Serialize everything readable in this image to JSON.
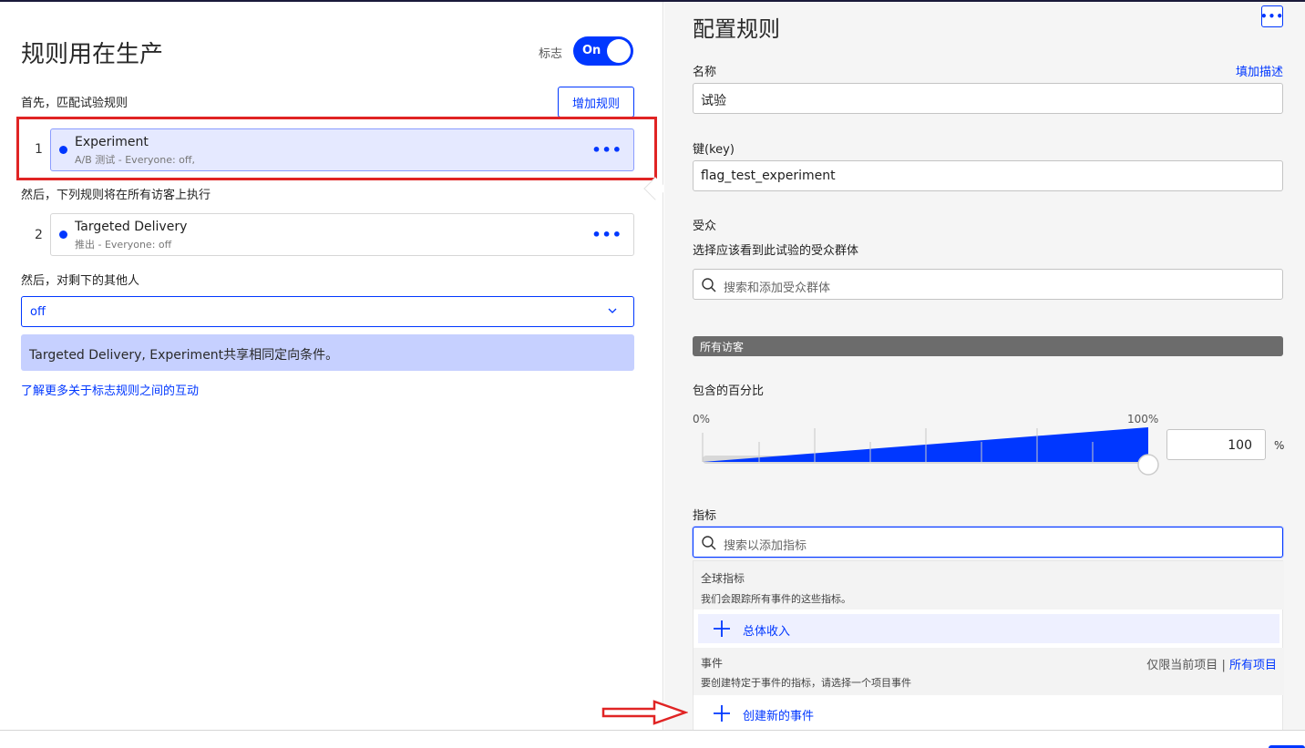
{
  "left": {
    "title": "规则用在生产",
    "flag_label": "标志",
    "toggle_label": "On",
    "first_label": "首先，匹配试验规则",
    "add_rule": "增加规则",
    "rules": [
      {
        "num": "1",
        "title": "Experiment",
        "subtitle": "A/B 测试 - Everyone: off,",
        "more": "•••"
      },
      {
        "num": "2",
        "title": "Targeted Delivery",
        "subtitle": "推出 - Everyone: off",
        "more": "•••"
      }
    ],
    "then_label": "然后，下列规则将在所有访客上执行",
    "rest_label": "然后，对剩下的其他人",
    "fallback_value": "off",
    "info_text": "Targeted Delivery, Experiment共享相同定向条件。",
    "learn_link": "了解更多关于标志规则之间的互动"
  },
  "right": {
    "title": "配置规则",
    "more": "•••",
    "name_label": "名称",
    "add_desc": "填加描述",
    "name_value": "试验",
    "key_label": "键(key)",
    "key_value": "flag_test_experiment",
    "audience_label": "受众",
    "audience_desc": "选择应该看到此试验的受众群体",
    "audience_placeholder": "搜索和添加受众群体",
    "audience_chip": "所有访客",
    "percent_label": "包含的百分比",
    "percent_min": "0%",
    "percent_max": "100%",
    "percent_value": "100",
    "percent_sign": "%",
    "slider_fraction": 1.0,
    "metrics_label": "指标",
    "metrics_placeholder": "搜索以添加指标",
    "global_title": "全球指标",
    "global_desc": "我们会跟踪所有事件的这些指标。",
    "global_item": "总体收入",
    "events_title": "事件",
    "events_desc": "要创建特定于事件的指标，请选择一个项目事件",
    "events_filter_current": "仅限当前项目",
    "events_filter_sep": "|",
    "events_filter_all": "所有项目",
    "create_event": "创建新的事件"
  },
  "colors": {
    "accent": "#0037ff",
    "highlight_red": "#e02424",
    "info_bg": "#c6d0ff",
    "chip_bg": "#6c6c6c"
  }
}
